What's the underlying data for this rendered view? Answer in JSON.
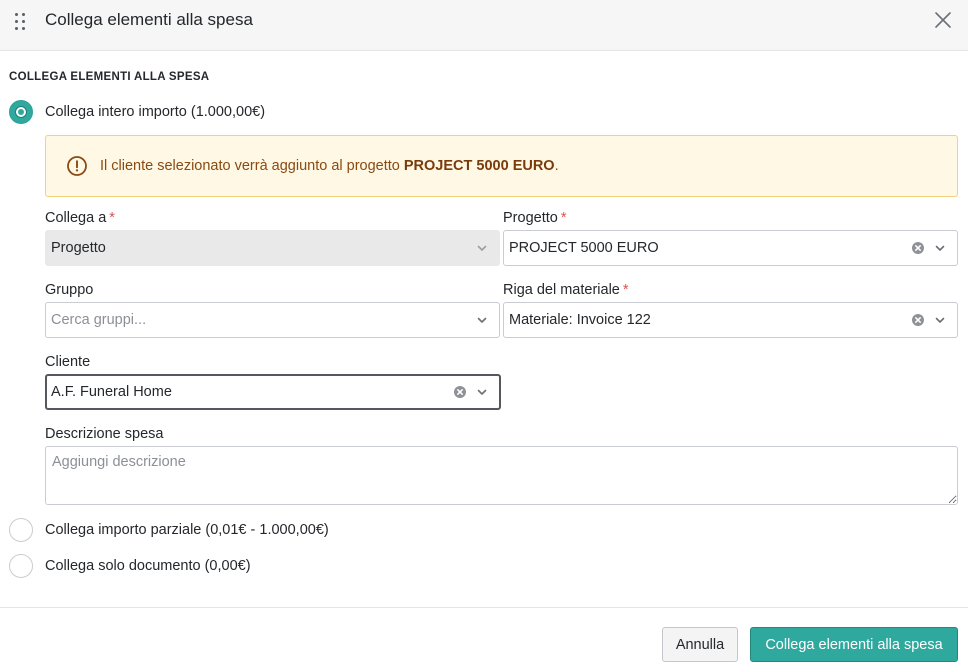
{
  "dialog": {
    "title": "Collega elementi alla spesa",
    "section_title": "COLLEGA ELEMENTI ALLA SPESA"
  },
  "options": {
    "full_amount": {
      "label": "Collega intero importo (1.000,00€)",
      "selected": true
    },
    "partial_amount": {
      "label": "Collega importo parziale (0,01€ - 1.000,00€)",
      "selected": false
    },
    "document_only": {
      "label": "Collega solo documento (0,00€)",
      "selected": false
    }
  },
  "alert": {
    "text_before": "Il cliente selezionato verrà aggiunto al progetto ",
    "project_name": "PROJECT 5000 EURO",
    "text_after": "."
  },
  "fields": {
    "collega_a": {
      "label": "Collega a",
      "required_mark": "*",
      "value": "Progetto"
    },
    "progetto": {
      "label": "Progetto",
      "required_mark": "*",
      "value": "PROJECT 5000 EURO"
    },
    "gruppo": {
      "label": "Gruppo",
      "placeholder": "Cerca gruppi..."
    },
    "riga_materiale": {
      "label": "Riga del materiale",
      "required_mark": "*",
      "value": "Materiale: Invoice 122"
    },
    "cliente": {
      "label": "Cliente",
      "value": "A.F. Funeral Home"
    },
    "descrizione": {
      "label": "Descrizione spesa",
      "placeholder": "Aggiungi descrizione"
    }
  },
  "footer": {
    "cancel_label": "Annulla",
    "confirm_label": "Collega elementi alla spesa"
  },
  "colors": {
    "accent": "#2fa99e",
    "alert_bg": "#fff8e5",
    "alert_border": "#f3d27d",
    "alert_text": "#8a4a12",
    "required": "#d9534f"
  },
  "icons": {
    "drag": "drag-handle-icon",
    "close": "close-icon",
    "alert": "exclamation-circle-icon",
    "clear": "clear-circle-icon",
    "dropdown": "chevron-down-icon"
  }
}
